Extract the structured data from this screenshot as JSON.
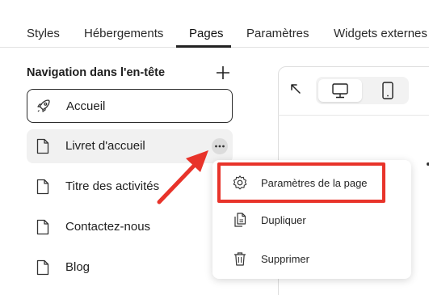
{
  "tabs": [
    {
      "label": "Styles"
    },
    {
      "label": "Hébergements"
    },
    {
      "label": "Pages",
      "active": true
    },
    {
      "label": "Paramètres"
    },
    {
      "label": "Widgets externes"
    }
  ],
  "sidebar": {
    "title": "Navigation dans l'en-tête",
    "add_icon": "plus-icon",
    "items": [
      {
        "label": "Accueil",
        "icon": "rocket-icon",
        "selected": true
      },
      {
        "label": "Livret d'accueil",
        "icon": "page-icon",
        "hovered": true
      },
      {
        "label": "Titre des activités",
        "icon": "page-icon"
      },
      {
        "label": "Contactez-nous",
        "icon": "page-icon"
      },
      {
        "label": "Blog",
        "icon": "page-icon"
      }
    ],
    "more_icon": "more-horizontal-icon"
  },
  "preview": {
    "collapse_icon": "collapse-arrow-icon",
    "devices": [
      {
        "name": "desktop",
        "icon": "monitor-icon",
        "active": true
      },
      {
        "name": "mobile",
        "icon": "mobile-icon"
      }
    ]
  },
  "context_menu": {
    "items": [
      {
        "label": "Paramètres de la page",
        "icon": "gear-icon",
        "highlighted": true
      },
      {
        "label": "Dupliquer",
        "icon": "duplicate-icon"
      },
      {
        "label": "Supprimer",
        "icon": "trash-icon"
      }
    ]
  },
  "colors": {
    "annotation_red": "#e8332a",
    "text": "#1e1e1e",
    "hover_bg": "#f1f1f1",
    "border": "#2b2b2b"
  }
}
